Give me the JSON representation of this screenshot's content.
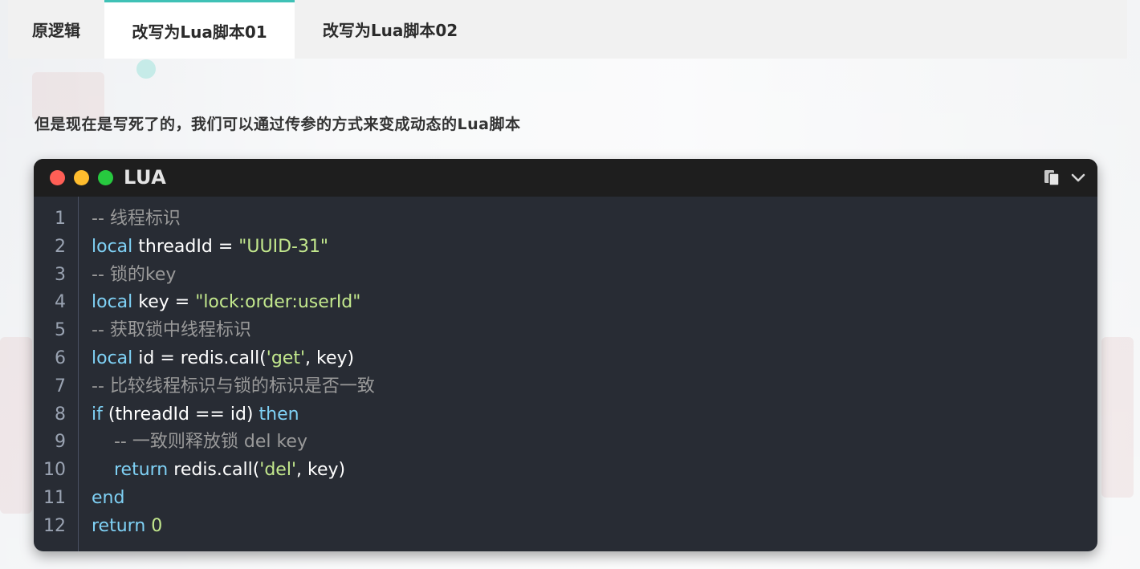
{
  "tabs": [
    {
      "label": "原逻辑",
      "active": false
    },
    {
      "label": "改写为Lua脚本01",
      "active": true
    },
    {
      "label": "改写为Lua脚本02",
      "active": false
    }
  ],
  "description": "但是现在是写死了的，我们可以通过传参的方式来变成动态的Lua脚本",
  "code_block": {
    "language": "LUA",
    "icons": [
      "copy-icon",
      "chevron-down-icon"
    ],
    "colors": {
      "keyword": "#7fd1f5",
      "string": "#c3e88d",
      "comment": "#9a9a9a",
      "plain": "#ffffff",
      "background": "#282c34",
      "header": "#1e1e1e",
      "tab_accent": "#3fc1b6"
    },
    "lines": [
      {
        "number": "1",
        "indent": "",
        "tokens": [
          {
            "type": "comment",
            "text": "-- 线程标识"
          }
        ]
      },
      {
        "number": "2",
        "indent": "",
        "tokens": [
          {
            "type": "kw",
            "text": "local"
          },
          {
            "type": "plain",
            "text": " threadId = "
          },
          {
            "type": "str",
            "text": "\"UUID-31\""
          }
        ]
      },
      {
        "number": "3",
        "indent": "",
        "tokens": [
          {
            "type": "comment",
            "text": "-- 锁的key"
          }
        ]
      },
      {
        "number": "4",
        "indent": "",
        "tokens": [
          {
            "type": "kw",
            "text": "local"
          },
          {
            "type": "plain",
            "text": " key = "
          },
          {
            "type": "str",
            "text": "\"lock:order:userId\""
          }
        ]
      },
      {
        "number": "5",
        "indent": "",
        "tokens": [
          {
            "type": "comment",
            "text": "-- 获取锁中线程标识"
          }
        ]
      },
      {
        "number": "6",
        "indent": "",
        "tokens": [
          {
            "type": "kw",
            "text": "local"
          },
          {
            "type": "plain",
            "text": " id = redis.call("
          },
          {
            "type": "str",
            "text": "'get'"
          },
          {
            "type": "plain",
            "text": ", key)"
          }
        ]
      },
      {
        "number": "7",
        "indent": "",
        "tokens": [
          {
            "type": "comment",
            "text": "-- 比较线程标识与锁的标识是否一致"
          }
        ]
      },
      {
        "number": "8",
        "indent": "",
        "tokens": [
          {
            "type": "kw",
            "text": "if"
          },
          {
            "type": "plain",
            "text": " (threadId == id) "
          },
          {
            "type": "kw",
            "text": "then"
          }
        ]
      },
      {
        "number": "9",
        "indent": "    ",
        "tokens": [
          {
            "type": "comment",
            "text": "-- 一致则释放锁 del key"
          }
        ]
      },
      {
        "number": "10",
        "indent": "    ",
        "tokens": [
          {
            "type": "kw",
            "text": "return"
          },
          {
            "type": "plain",
            "text": " redis.call("
          },
          {
            "type": "str",
            "text": "'del'"
          },
          {
            "type": "plain",
            "text": ", key)"
          }
        ]
      },
      {
        "number": "11",
        "indent": "",
        "tokens": [
          {
            "type": "kw",
            "text": "end"
          }
        ]
      },
      {
        "number": "12",
        "indent": "",
        "tokens": [
          {
            "type": "kw",
            "text": "return"
          },
          {
            "type": "plain",
            "text": " "
          },
          {
            "type": "num",
            "text": "0"
          }
        ]
      }
    ]
  }
}
